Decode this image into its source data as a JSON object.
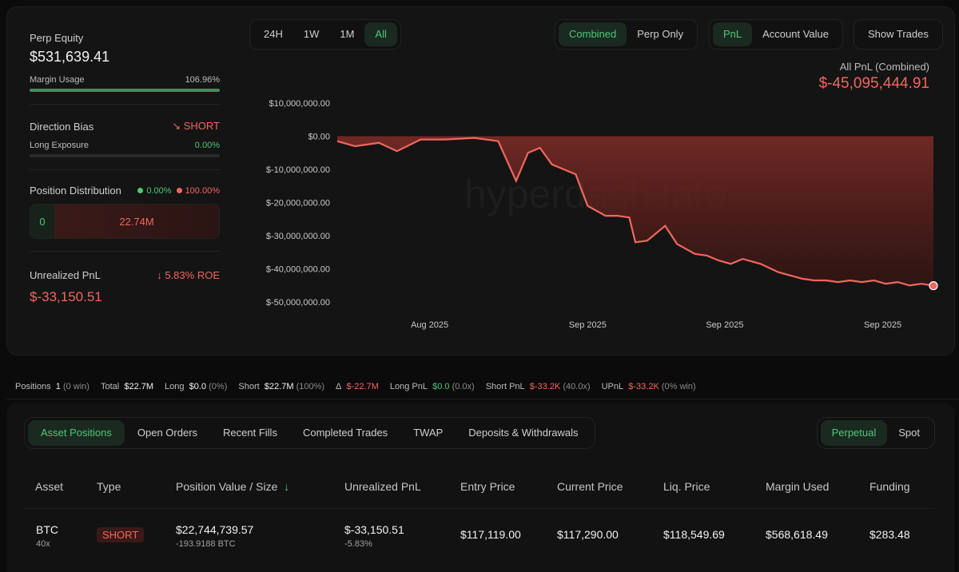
{
  "equity": {
    "label": "Perp Equity",
    "value": "$531,639.41",
    "margin_label": "Margin Usage",
    "margin_value": "106.96%",
    "margin_fill": 1.0
  },
  "direction": {
    "label": "Direction Bias",
    "value": "SHORT",
    "exposure_label": "Long Exposure",
    "exposure_value": "0.00%",
    "exposure_fill": 0.0
  },
  "distribution": {
    "label": "Position Distribution",
    "long_pct": "0.00%",
    "short_pct": "100.00%",
    "long_value": "0",
    "short_value": "22.74M"
  },
  "unrealized": {
    "label": "Unrealized PnL",
    "roe": "5.83% ROE",
    "value": "$-33,150.51"
  },
  "range_tabs": [
    {
      "label": "24H",
      "active": false
    },
    {
      "label": "1W",
      "active": false
    },
    {
      "label": "1M",
      "active": false
    },
    {
      "label": "All",
      "active": true
    }
  ],
  "mode_tabs": [
    {
      "label": "Combined",
      "active": true
    },
    {
      "label": "Perp Only",
      "active": false
    }
  ],
  "metric_tabs": [
    {
      "label": "PnL",
      "active": true
    },
    {
      "label": "Account Value",
      "active": false
    }
  ],
  "show_trades_label": "Show Trades",
  "pnl_header": {
    "title": "All PnL (Combined)",
    "value": "$-45,095,444.91"
  },
  "chart_data": {
    "type": "area",
    "yticks": [
      "$10,000,000.00",
      "$0.00",
      "$-10,000,000.00",
      "$-20,000,000.00",
      "$-30,000,000.00",
      "$-40,000,000.00",
      "$-50,000,000.00"
    ],
    "ylim": [
      -50000000,
      10000000
    ],
    "xticks": [
      "Aug 2025",
      "Sep 2025",
      "Sep 2025",
      "Sep 2025"
    ],
    "x": [
      0,
      0.03,
      0.07,
      0.1,
      0.14,
      0.18,
      0.23,
      0.27,
      0.3,
      0.32,
      0.34,
      0.36,
      0.38,
      0.4,
      0.42,
      0.45,
      0.47,
      0.49,
      0.5,
      0.52,
      0.55,
      0.57,
      0.6,
      0.62,
      0.64,
      0.66,
      0.68,
      0.71,
      0.74,
      0.76,
      0.78,
      0.8,
      0.82,
      0.84,
      0.86,
      0.88,
      0.9,
      0.92,
      0.94,
      0.96,
      0.98,
      1.0
    ],
    "values": [
      -1500000,
      -3000000,
      -2000000,
      -4500000,
      -1000000,
      -1000000,
      -500000,
      -1500000,
      -13500000,
      -5000000,
      -3500000,
      -8500000,
      -10000000,
      -11500000,
      -21000000,
      -24000000,
      -24000000,
      -24500000,
      -32000000,
      -31500000,
      -27000000,
      -32500000,
      -35500000,
      -36000000,
      -37500000,
      -38500000,
      -37000000,
      -38500000,
      -41000000,
      -42000000,
      -43000000,
      -43500000,
      -43500000,
      -44000000,
      -43500000,
      -44000000,
      -43500000,
      -44500000,
      -44000000,
      -45000000,
      -44500000,
      -45095444
    ],
    "watermark": "hyperdash.info"
  },
  "summary": {
    "positions_label": "Positions",
    "positions_value": "1",
    "positions_win": "(0 win)",
    "total_label": "Total",
    "total_value": "$22.7M",
    "long_label": "Long",
    "long_value": "$0.0",
    "long_pct": "(0%)",
    "short_label": "Short",
    "short_value": "$22.7M",
    "short_pct": "(100%)",
    "delta_label": "Δ",
    "delta_value": "$-22.7M",
    "longpnl_label": "Long PnL",
    "longpnl_value": "$0.0",
    "longpnl_x": "(0.0x)",
    "shortpnl_label": "Short PnL",
    "shortpnl_value": "$-33.2K",
    "shortpnl_x": "(40.0x)",
    "upnl_label": "UPnL",
    "upnl_value": "$-33.2K",
    "upnl_win": "(0% win)"
  },
  "bottom_tabs": [
    {
      "label": "Asset Positions",
      "active": true
    },
    {
      "label": "Open Orders",
      "active": false
    },
    {
      "label": "Recent Fills",
      "active": false
    },
    {
      "label": "Completed Trades",
      "active": false
    },
    {
      "label": "TWAP",
      "active": false
    },
    {
      "label": "Deposits & Withdrawals",
      "active": false
    }
  ],
  "market_tabs": [
    {
      "label": "Perpetual",
      "active": true
    },
    {
      "label": "Spot",
      "active": false
    }
  ],
  "table": {
    "headers": [
      "Asset",
      "Type",
      "Position Value / Size",
      "Unrealized PnL",
      "Entry Price",
      "Current Price",
      "Liq. Price",
      "Margin Used",
      "Funding"
    ],
    "sort_icon": "arrow-down-icon",
    "row": {
      "asset": "BTC",
      "leverage": "40x",
      "type": "SHORT",
      "value": "$22,744,739.57",
      "size": "-193.9188 BTC",
      "upnl": "$-33,150.51",
      "upnl_pct": "-5.83%",
      "entry": "$117,119.00",
      "current": "$117,290.00",
      "liq": "$118,549.69",
      "margin": "$568,618.49",
      "funding": "$283.48"
    }
  }
}
